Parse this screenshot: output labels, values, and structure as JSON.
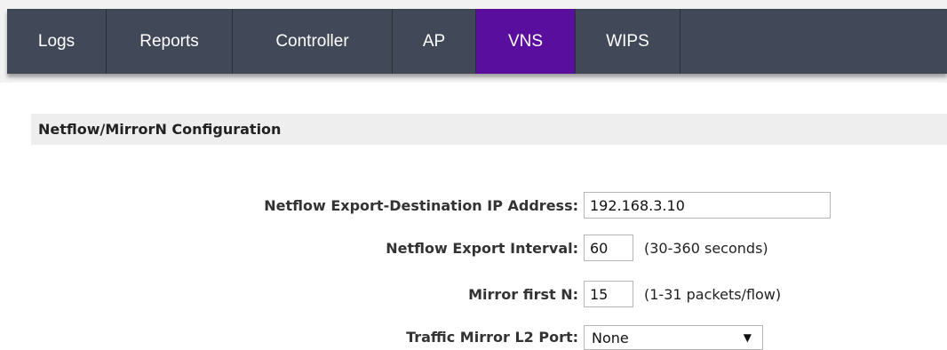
{
  "tabs": [
    {
      "label": "Logs",
      "active": false
    },
    {
      "label": "Reports",
      "active": false
    },
    {
      "label": "Controller",
      "active": false
    },
    {
      "label": "AP",
      "active": false
    },
    {
      "label": "VNS",
      "active": true
    },
    {
      "label": "WIPS",
      "active": false
    }
  ],
  "colors": {
    "tab_bar": "#414958",
    "tab_active": "#5a0e9e",
    "section_header_bg": "#eeeeee"
  },
  "section": {
    "title": "Netflow/MirrorN Configuration"
  },
  "form": {
    "dest_ip": {
      "label": "Netflow Export-Destination IP Address:",
      "value": "192.168.3.10"
    },
    "interval": {
      "label": "Netflow Export Interval:",
      "value": "60",
      "hint": "(30-360 seconds)"
    },
    "mirror_n": {
      "label": "Mirror first N:",
      "value": "15",
      "hint": "(1-31 packets/flow)"
    },
    "l2_port": {
      "label": "Traffic Mirror L2 Port:",
      "selected": "None",
      "arrow_icon": "dropdown-arrow-icon"
    }
  }
}
